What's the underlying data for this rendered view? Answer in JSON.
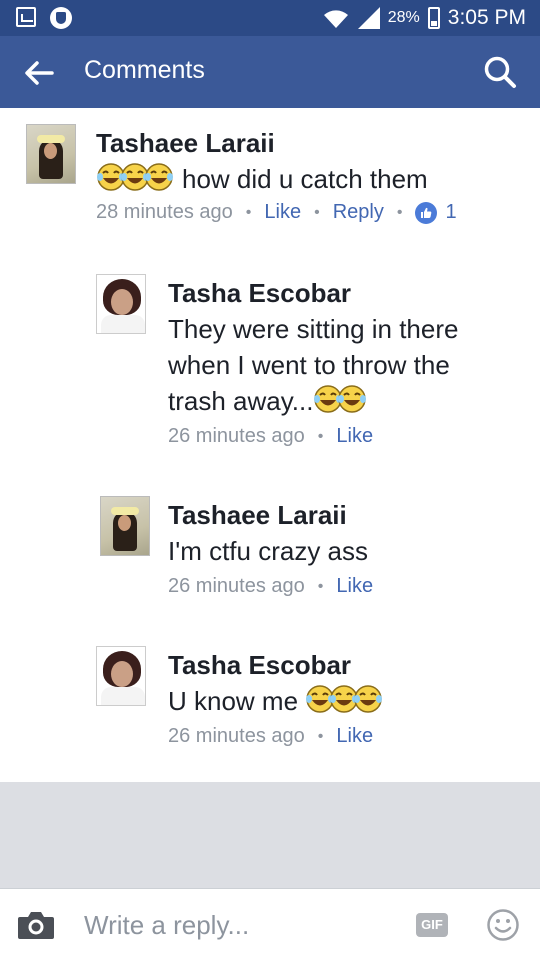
{
  "status_bar": {
    "battery": "28%",
    "time": "3:05 PM"
  },
  "app_bar": {
    "title": "Comments"
  },
  "comments": [
    {
      "name": "Tashaee Laraii",
      "emojis_before": 3,
      "text": "how did u catch them",
      "time": "28 minutes ago",
      "like_label": "Like",
      "reply_label": "Reply",
      "like_count": "1"
    },
    {
      "name": "Tasha Escobar",
      "text_line1": "They were sitting in there",
      "text_line2": "when I went to throw the",
      "text_line3": "trash away...",
      "emojis_after": 2,
      "time": "26 minutes ago",
      "like_label": "Like"
    },
    {
      "name": "Tashaee Laraii",
      "text": "I'm ctfu crazy ass",
      "time": "26 minutes ago",
      "like_label": "Like"
    },
    {
      "name": "Tasha Escobar",
      "text": "U know me",
      "emojis_after": 3,
      "time": "26 minutes ago",
      "like_label": "Like"
    }
  ],
  "composer": {
    "placeholder": "Write a reply...",
    "gif_label": "GIF"
  },
  "icons": {
    "status_left": [
      "gallery-icon",
      "shield-icon"
    ],
    "status_right": [
      "wifi-icon",
      "signal-icon",
      "battery-icon"
    ],
    "app_bar": [
      "back-arrow-icon",
      "search-icon"
    ],
    "composer": [
      "camera-icon",
      "gif-icon",
      "smiley-icon"
    ],
    "reaction": "laughing-tears-emoji"
  },
  "colors": {
    "status_bar": "#2c4a86",
    "app_bar": "#3b5998",
    "link": "#4267b2",
    "meta": "#8d949e",
    "like_badge": "#4b7bd8"
  }
}
